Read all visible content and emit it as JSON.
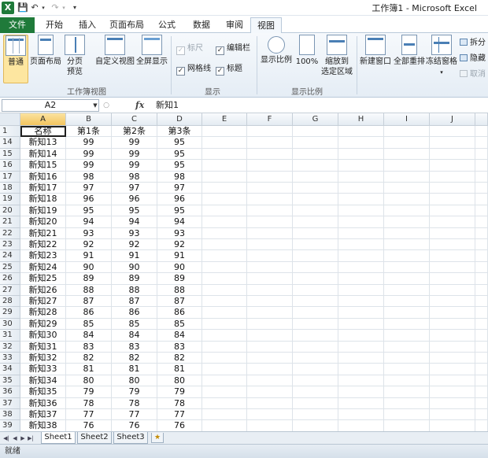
{
  "titlebar": {
    "app_icon": "X",
    "title": "工作簿1 - Microsoft Excel",
    "quick_access": [
      "save-icon",
      "undo-icon",
      "redo-icon",
      "customize-icon"
    ]
  },
  "tabs": [
    {
      "label": "文件"
    },
    {
      "label": "开始"
    },
    {
      "label": "插入"
    },
    {
      "label": "页面布局"
    },
    {
      "label": "公式"
    },
    {
      "label": "数据"
    },
    {
      "label": "审阅"
    },
    {
      "label": "视图"
    }
  ],
  "active_tab": "视图",
  "ribbon": {
    "workbook_views": {
      "group_label": "工作簿视图",
      "normal": "普通",
      "page_layout": "页面布局",
      "page_break_1": "分页",
      "page_break_2": "预览",
      "custom_views": "自定义视图",
      "full_screen": "全屏显示"
    },
    "show": {
      "group_label": "显示",
      "ruler": "标尺",
      "gridlines": "网格线",
      "formula_bar": "编辑栏",
      "headings": "标题"
    },
    "zoom": {
      "group_label": "显示比例",
      "zoom": "显示比例",
      "hundred": "100%",
      "zoom_sel_1": "缩放到",
      "zoom_sel_2": "选定区域"
    },
    "window": {
      "new_window": "新建窗口",
      "arrange_all": "全部重排",
      "freeze_panes": "冻结窗格",
      "split": "拆分",
      "hide": "隐藏",
      "unhide": "取消"
    }
  },
  "formula_bar": {
    "name_box": "A2",
    "fx": "fx",
    "value": "新知1"
  },
  "columns": [
    "A",
    "B",
    "C",
    "D",
    "E",
    "F",
    "G",
    "H",
    "I",
    "J"
  ],
  "header_row": {
    "num": "1",
    "a": "名称",
    "b": "第1条",
    "c": "第2条",
    "d": "第3条"
  },
  "rows": [
    {
      "num": "14",
      "a": "新知13",
      "b": "99",
      "c": "99",
      "d": "95"
    },
    {
      "num": "15",
      "a": "新知14",
      "b": "99",
      "c": "99",
      "d": "95"
    },
    {
      "num": "16",
      "a": "新知15",
      "b": "99",
      "c": "99",
      "d": "95"
    },
    {
      "num": "17",
      "a": "新知16",
      "b": "98",
      "c": "98",
      "d": "98"
    },
    {
      "num": "18",
      "a": "新知17",
      "b": "97",
      "c": "97",
      "d": "97"
    },
    {
      "num": "19",
      "a": "新知18",
      "b": "96",
      "c": "96",
      "d": "96"
    },
    {
      "num": "20",
      "a": "新知19",
      "b": "95",
      "c": "95",
      "d": "95"
    },
    {
      "num": "21",
      "a": "新知20",
      "b": "94",
      "c": "94",
      "d": "94"
    },
    {
      "num": "22",
      "a": "新知21",
      "b": "93",
      "c": "93",
      "d": "93"
    },
    {
      "num": "23",
      "a": "新知22",
      "b": "92",
      "c": "92",
      "d": "92"
    },
    {
      "num": "24",
      "a": "新知23",
      "b": "91",
      "c": "91",
      "d": "91"
    },
    {
      "num": "25",
      "a": "新知24",
      "b": "90",
      "c": "90",
      "d": "90"
    },
    {
      "num": "26",
      "a": "新知25",
      "b": "89",
      "c": "89",
      "d": "89"
    },
    {
      "num": "27",
      "a": "新知26",
      "b": "88",
      "c": "88",
      "d": "88"
    },
    {
      "num": "28",
      "a": "新知27",
      "b": "87",
      "c": "87",
      "d": "87"
    },
    {
      "num": "29",
      "a": "新知28",
      "b": "86",
      "c": "86",
      "d": "86"
    },
    {
      "num": "30",
      "a": "新知29",
      "b": "85",
      "c": "85",
      "d": "85"
    },
    {
      "num": "31",
      "a": "新知30",
      "b": "84",
      "c": "84",
      "d": "84"
    },
    {
      "num": "32",
      "a": "新知31",
      "b": "83",
      "c": "83",
      "d": "83"
    },
    {
      "num": "33",
      "a": "新知32",
      "b": "82",
      "c": "82",
      "d": "82"
    },
    {
      "num": "34",
      "a": "新知33",
      "b": "81",
      "c": "81",
      "d": "81"
    },
    {
      "num": "35",
      "a": "新知34",
      "b": "80",
      "c": "80",
      "d": "80"
    },
    {
      "num": "36",
      "a": "新知35",
      "b": "79",
      "c": "79",
      "d": "79"
    },
    {
      "num": "37",
      "a": "新知36",
      "b": "78",
      "c": "78",
      "d": "78"
    },
    {
      "num": "38",
      "a": "新知37",
      "b": "77",
      "c": "77",
      "d": "77"
    },
    {
      "num": "39",
      "a": "新知38",
      "b": "76",
      "c": "76",
      "d": "76"
    }
  ],
  "sheets": [
    "Sheet1",
    "Sheet2",
    "Sheet3"
  ],
  "active_sheet": "Sheet1",
  "status": "就绪",
  "colors": {
    "file_tab": "#1f7a3a",
    "selected_header": "#f3c55f",
    "selection_border": "#1f1f1f"
  }
}
